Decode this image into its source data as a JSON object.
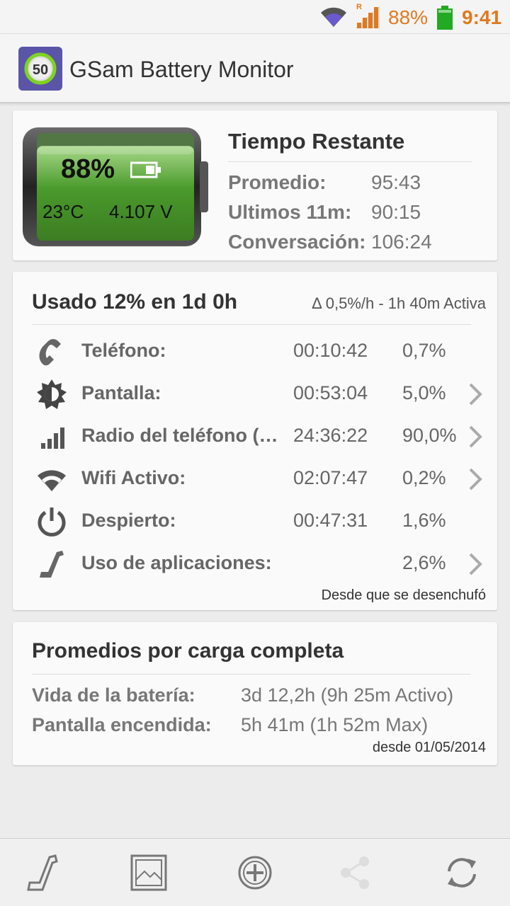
{
  "status_bar": {
    "roaming": "R",
    "battery_percent": "88%",
    "time": "9:41",
    "accent_color": "#e07a1f",
    "battery_icon_color": "#22aa22"
  },
  "app": {
    "title": "GSam Battery Monitor",
    "icon_badge": "50",
    "icon_color": "#5b55a8"
  },
  "battery": {
    "percent": "88%",
    "level": 0.88,
    "temperature": "23°C",
    "voltage": "4.107 V"
  },
  "tiempo_restante": {
    "title": "Tiempo Restante",
    "rows": [
      {
        "label": "Promedio:",
        "value": "95:43"
      },
      {
        "label": "Ultimos 11m:",
        "value": "90:15"
      },
      {
        "label": "Conversación:",
        "value": "106:24"
      }
    ]
  },
  "usage": {
    "title": "Usado 12% en 1d 0h",
    "rate": "Δ 0,5%/h - 1h 40m Activa",
    "footer": "Desde que se desenchufó",
    "items": [
      {
        "name": "Teléfono:",
        "time": "00:10:42",
        "percent": "0,7%",
        "icon": "phone-icon",
        "has_chevron": false
      },
      {
        "name": "Pantalla:",
        "time": "00:53:04",
        "percent": "5,0%",
        "icon": "brightness-icon",
        "has_chevron": true
      },
      {
        "name": "Radio del teléfono (…",
        "time": "24:36:22",
        "percent": "90,0%",
        "icon": "signal-bars-icon",
        "has_chevron": true
      },
      {
        "name": "Wifi Activo:",
        "time": "02:07:47",
        "percent": "0,2%",
        "icon": "wifi-icon",
        "has_chevron": true
      },
      {
        "name": "Despierto:",
        "time": "00:47:31",
        "percent": "1,6%",
        "icon": "power-icon",
        "has_chevron": false
      },
      {
        "name": "Uso de aplicaciones:",
        "time": "",
        "percent": "2,6%",
        "icon": "app-usage-icon",
        "has_chevron": true
      }
    ]
  },
  "promedios": {
    "title": "Promedios por carga completa",
    "rows": [
      {
        "label": "Vida de la batería:",
        "value": "3d 12,2h (9h 25m Activo)"
      },
      {
        "label": "Pantalla encendida:",
        "value": "5h 41m (1h 52m Max)"
      }
    ],
    "footer": "desde 01/05/2014"
  },
  "bottom_bar": {
    "buttons": [
      "app-usage-icon",
      "image-icon",
      "add-icon",
      "share-icon",
      "refresh-icon"
    ]
  }
}
